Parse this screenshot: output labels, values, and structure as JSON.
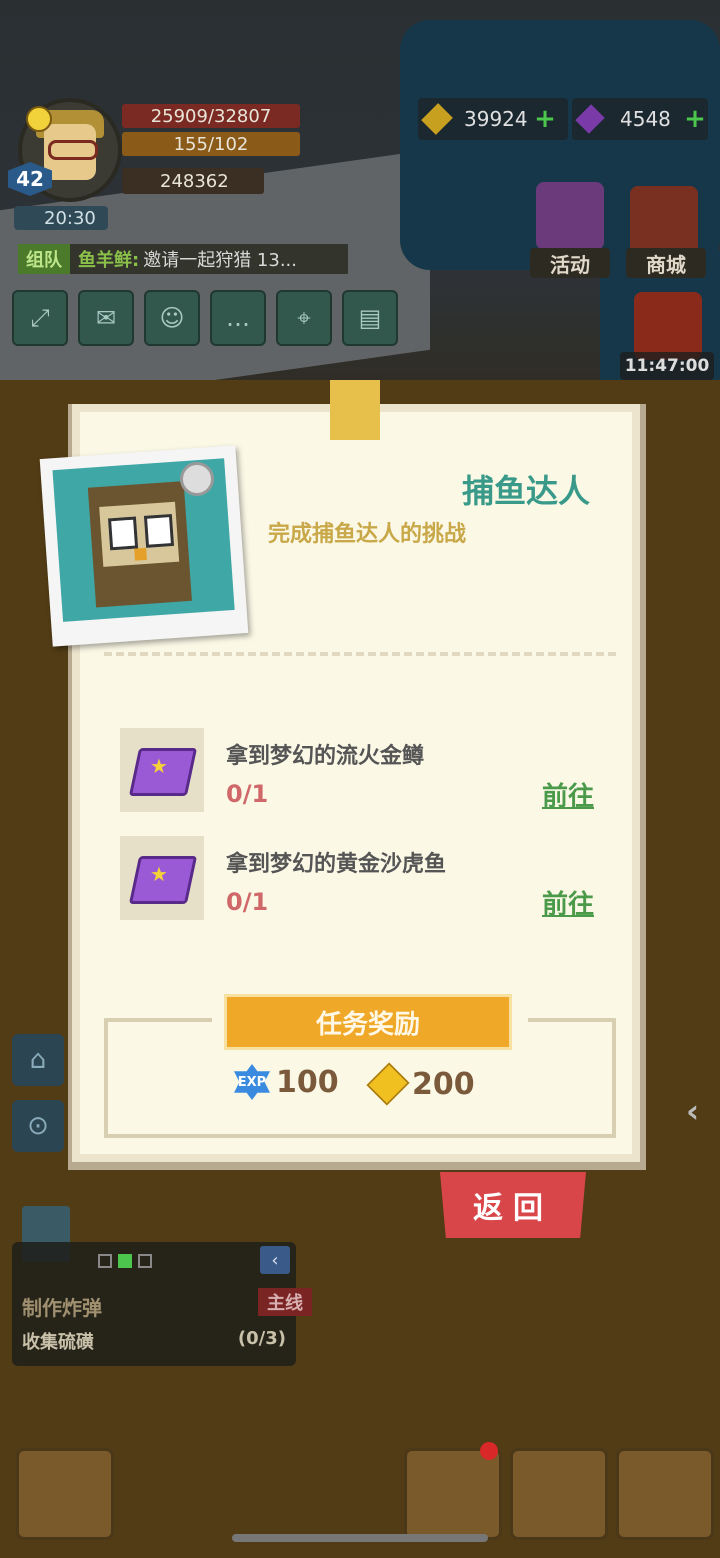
{
  "player": {
    "level": "42",
    "hp": "25909/32807",
    "energy": "155/102",
    "power": "248362",
    "timer": "20:30"
  },
  "currencies": [
    {
      "name": "gold-coin",
      "value": "39924"
    },
    {
      "name": "purple-gem",
      "value": "4548"
    }
  ],
  "chat": {
    "tag": "组队",
    "sender": "鱼羊鲜:",
    "message": "邀请一起狩猎 13..."
  },
  "side_buttons": {
    "activity": "活动",
    "store": "商城",
    "gift_timer": "11:47:00"
  },
  "modal": {
    "title": "捕鱼达人",
    "description": "完成捕鱼达人的挑战",
    "tasks": [
      {
        "name": "拿到梦幻的流火金鳟",
        "progress": "0/1",
        "action": "前往"
      },
      {
        "name": "拿到梦幻的黄金沙虎鱼",
        "progress": "0/1",
        "action": "前往"
      }
    ],
    "reward_title": "任务奖励",
    "rewards": [
      {
        "icon": "exp-icon",
        "icon_text": "EXP",
        "value": "100"
      },
      {
        "icon": "gold-coin-icon",
        "value": "200"
      }
    ],
    "back_label": "返回"
  },
  "quest_tracker": {
    "title": "制作炸弹",
    "tag": "主线",
    "objective": "收集硫磺",
    "progress": "(0/3)"
  },
  "colors": {
    "title_teal": "#3a9a8a",
    "desc_gold": "#c8a848",
    "progress_red": "#d0686a",
    "go_green": "#4a9a4a",
    "reward_orange": "#f0a828",
    "back_red": "#d9464a"
  }
}
